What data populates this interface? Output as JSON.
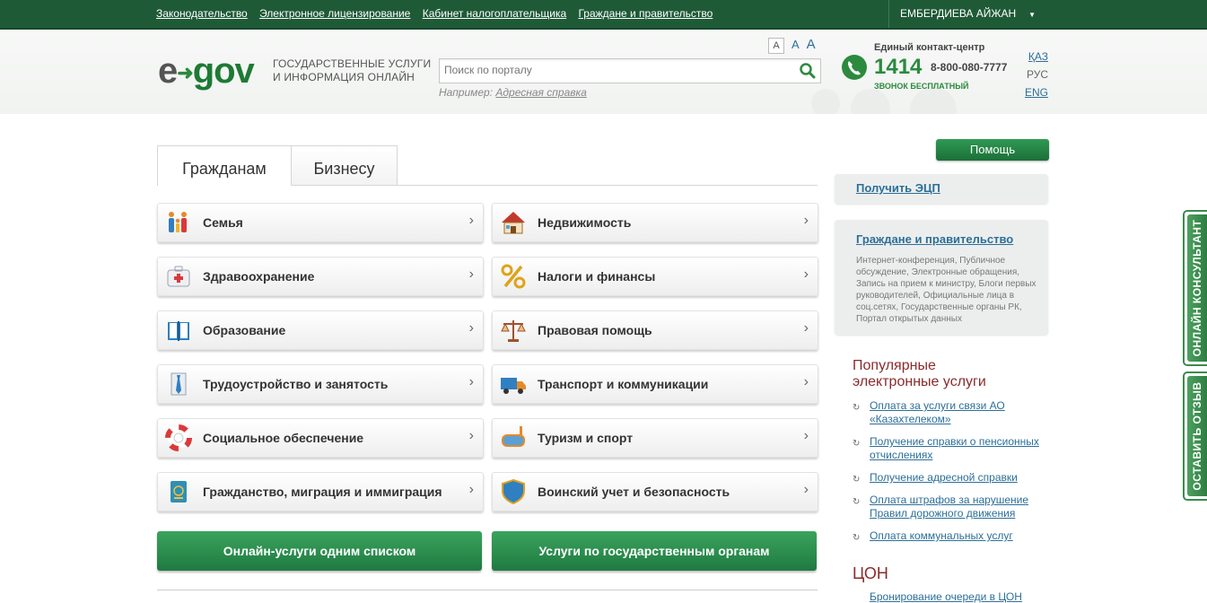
{
  "topbar": {
    "links": [
      "Законодательство",
      "Электронное лицензирование",
      "Кабинет налогоплательщика",
      "Граждане и правительство"
    ],
    "user": "ЕМБЕРДИЕВА АЙЖАН"
  },
  "header": {
    "logo_e": "e",
    "logo_gov": "gov",
    "slogan_line1": "ГОСУДАРСТВЕННЫЕ УСЛУГИ",
    "slogan_line2": "И ИНФОРМАЦИЯ ОНЛАЙН",
    "search_placeholder": "Поиск по порталу",
    "example_prefix": "Например:",
    "example_link": "Адресная справка",
    "font_sizes": [
      "A",
      "A",
      "A"
    ],
    "contact_title": "Единый контакт-центр",
    "contact_number": "1414",
    "contact_phone": "8-800-080-7777",
    "contact_free": "ЗВОНОК БЕСПЛАТНЫЙ",
    "languages": [
      "ҚАЗ",
      "РУС",
      "ENG"
    ]
  },
  "tabs": [
    "Гражданам",
    "Бизнесу"
  ],
  "categories": [
    {
      "label": "Семья",
      "icon": "family-icon"
    },
    {
      "label": "Недвижимость",
      "icon": "house-icon"
    },
    {
      "label": "Здравоохранение",
      "icon": "medkit-icon"
    },
    {
      "label": "Налоги и финансы",
      "icon": "percent-icon"
    },
    {
      "label": "Образование",
      "icon": "book-icon"
    },
    {
      "label": "Правовая помощь",
      "icon": "scales-icon"
    },
    {
      "label": "Трудоустройство и занятость",
      "icon": "tie-icon"
    },
    {
      "label": "Транспорт и коммуникации",
      "icon": "truck-icon"
    },
    {
      "label": "Социальное обеспечение",
      "icon": "lifebuoy-icon"
    },
    {
      "label": "Туризм и спорт",
      "icon": "diving-mask-icon"
    },
    {
      "label": "Гражданство, миграция и иммиграция",
      "icon": "passport-icon"
    },
    {
      "label": "Воинский учет и безопасность",
      "icon": "shield-icon"
    }
  ],
  "buttons": {
    "online_list": "Онлайн-услуги одним списком",
    "by_agency": "Услуги по государственным органам"
  },
  "sidebar": {
    "help": "Помощь",
    "ecp": "Получить ЭЦП",
    "gov_title": "Граждане и правительство",
    "gov_desc": "Интернет-конференция, Публичное обсуждение, Электронные обращения, Запись на прием к министру, Блоги первых руководителей, Официальные лица в соц.сетях, Государственные органы РК, Портал открытых данных",
    "popular_title_1": "Популярные",
    "popular_title_2": "электронные услуги",
    "popular": [
      "Оплата за услуги связи АО «Казахтелеком»",
      "Получение справки о пенсионных отчислениях",
      "Получение адресной справки",
      "Оплата штрафов за нарушение Правил дорожного движения",
      "Оплата коммунальных услуг"
    ],
    "con_title": "ЦОН",
    "con_item": "Бронирование очереди в ЦОН"
  },
  "side_tabs": {
    "consultant": "ОНЛАЙН КОНСУЛЬТАНТ",
    "feedback": "ОСТАВИТЬ ОТЗЫВ"
  },
  "colors": {
    "brand_green": "#1f5a37",
    "accent_green": "#2b8a3e",
    "link_blue": "#2c6f98",
    "section_red": "#8b2b2b"
  }
}
